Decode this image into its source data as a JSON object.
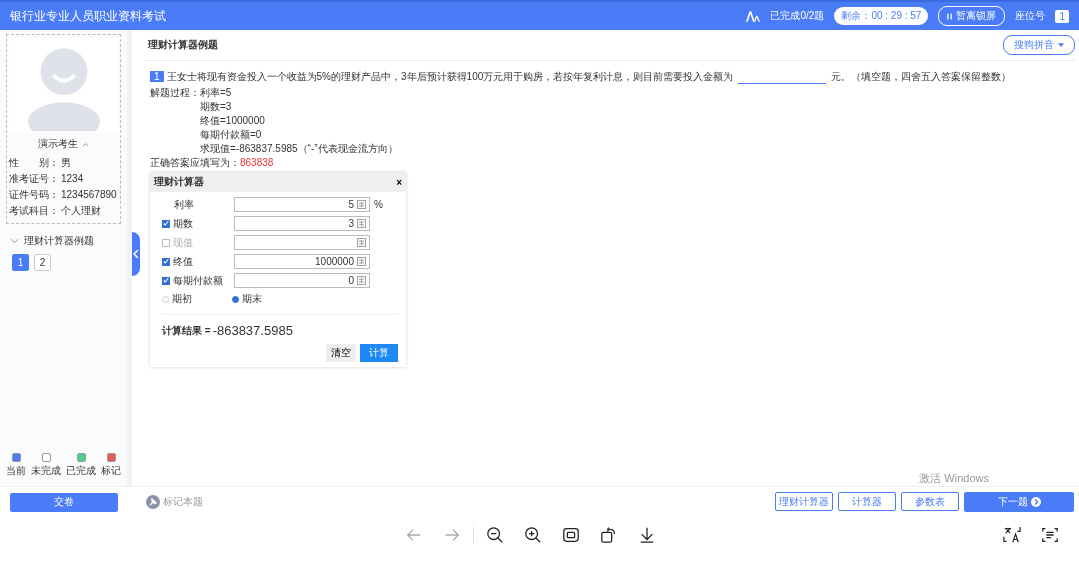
{
  "header": {
    "title": "银行业专业人员职业资料考试",
    "progress": "已完成0/2题",
    "timer": "剩余：00 : 29 : 57",
    "lock_button": "暂离锁屏",
    "seat_label": "座位号",
    "seat_number": "1"
  },
  "candidate": {
    "name": "演示考生",
    "fields": [
      {
        "label": "性　　别：",
        "value": "男"
      },
      {
        "label": "准考证号：",
        "value": "1234"
      },
      {
        "label": "证件号码：",
        "value": "1234567890"
      },
      {
        "label": "考试科目：",
        "value": "个人理财"
      }
    ]
  },
  "section": {
    "title": "理财计算器例题",
    "expanded": true,
    "questions": [
      {
        "label": "1",
        "selected": true
      },
      {
        "label": "2",
        "selected": false
      }
    ]
  },
  "legend": [
    {
      "label": "当前",
      "color": "#4a7cf7"
    },
    {
      "label": "未完成",
      "color": "#ffffff"
    },
    {
      "label": "已完成",
      "color": "#4cd08d"
    },
    {
      "label": "标记",
      "color": "#e85a5a"
    }
  ],
  "submit_button": "交卷",
  "mark_button": "标记本题",
  "main": {
    "title": "理财计算器例题",
    "ime_button": "搜狗拼音",
    "question": {
      "number": "1",
      "text_before": "王女士将现有资金投入一个收益为5%的理财产品中，3年后预计获得100万元用于购房，若按年复利计息，则目前需要投入金额为",
      "text_after": "元。（填空题，四舍五入答案保留整数）"
    },
    "solution_label": "解题过程：",
    "solution_lines": [
      "利率=5",
      "期数=3",
      "终值=1000000",
      "每期付款额=0",
      "求现值=-863837.5985（“-”代表现金流方向）"
    ],
    "answer_label": "正确答案应填写为：",
    "answer_value": "863838"
  },
  "calculator": {
    "title": "理财计算器",
    "close": "×",
    "fields": [
      {
        "kind": "plain",
        "label": "利率",
        "value": "5",
        "unit": "%"
      },
      {
        "kind": "checkbox",
        "label": "期数",
        "checked": true,
        "value": "3"
      },
      {
        "kind": "checkbox",
        "label": "现值",
        "checked": false
      },
      {
        "kind": "checkbox",
        "label": "终值",
        "checked": true,
        "value": "1000000"
      },
      {
        "kind": "checkbox",
        "label": "每期付款额",
        "checked": true,
        "value": "0"
      }
    ],
    "timing": [
      {
        "label": "期初",
        "selected": false
      },
      {
        "label": "期末",
        "selected": true
      }
    ],
    "result_label": "计算结果 =",
    "result_value": "-863837.5985",
    "clear_button": "清空",
    "compute_button": "计算"
  },
  "tool_buttons": [
    "理财计算器",
    "计算器",
    "参数表"
  ],
  "next_button": "下一题",
  "os_notice": "激活 Windows"
}
